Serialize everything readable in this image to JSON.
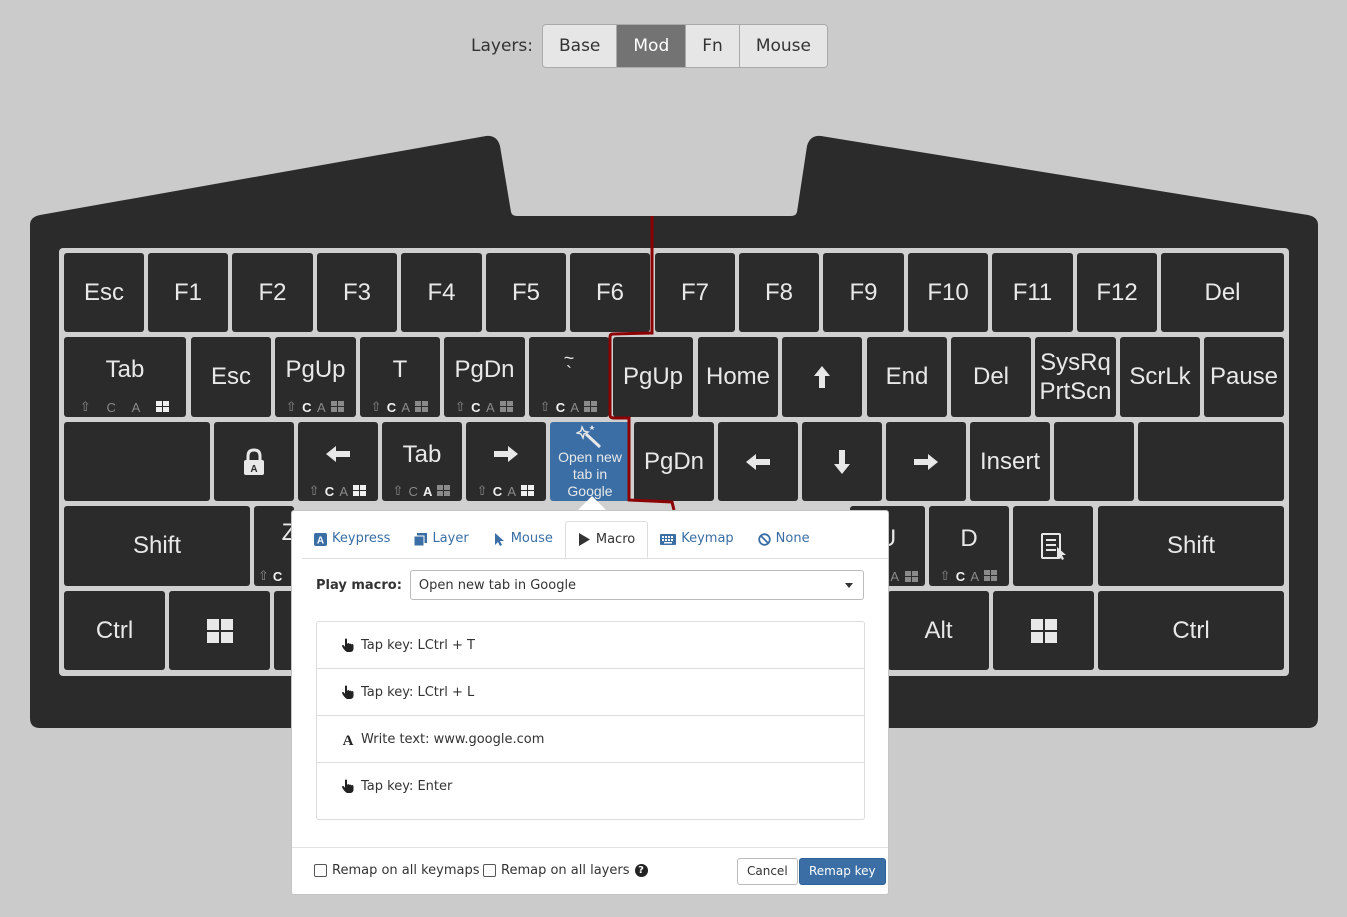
{
  "layers": {
    "label": "Layers:",
    "items": [
      {
        "label": "Base",
        "active": false
      },
      {
        "label": "Mod",
        "active": true
      },
      {
        "label": "Fn",
        "active": false
      },
      {
        "label": "Mouse",
        "active": false
      }
    ]
  },
  "keys": {
    "esc": "Esc",
    "f1": "F1",
    "f2": "F2",
    "f3": "F3",
    "f4": "F4",
    "f5": "F5",
    "f6": "F6",
    "f7": "F7",
    "f8": "F8",
    "f9": "F9",
    "f10": "F10",
    "f11": "F11",
    "f12": "F12",
    "del": "Del",
    "tab_l": "Tab",
    "esc2": "Esc",
    "pgup_l": "PgUp",
    "t": "T",
    "pgdn_l": "PgDn",
    "tilde": "~",
    "backtick": "`",
    "pgup_r": "PgUp",
    "home": "Home",
    "end": "End",
    "del2": "Del",
    "sysrq": "SysRq",
    "prtscn": "PrtScn",
    "scrlk": "ScrLk",
    "pause": "Pause",
    "tab2": "Tab",
    "macro_key": "Open new\ntab in Google",
    "pgdn_r": "PgDn",
    "insert": "Insert",
    "shift_l": "Shift",
    "z_partial": "Z",
    "u_partial": "U",
    "d": "D",
    "shift_r": "Shift",
    "ctrl_l": "Ctrl",
    "alt_r": "Alt",
    "ctrl_r": "Ctrl",
    "mod_c": "C",
    "mod_a": "A"
  },
  "popover": {
    "tabs": [
      {
        "label": "Keypress",
        "icon": "keypress-icon",
        "active": false
      },
      {
        "label": "Layer",
        "icon": "layer-icon",
        "active": false
      },
      {
        "label": "Mouse",
        "icon": "mouse-pointer-icon",
        "active": false
      },
      {
        "label": "Macro",
        "icon": "play-icon",
        "active": true
      },
      {
        "label": "Keymap",
        "icon": "keyboard-icon",
        "active": false
      },
      {
        "label": "None",
        "icon": "ban-icon",
        "active": false
      }
    ],
    "play_macro_label": "Play macro:",
    "selected_macro": "Open new tab in Google",
    "actions": [
      {
        "icon": "hand-pointer-icon",
        "text": "Tap key: LCtrl + T"
      },
      {
        "icon": "hand-pointer-icon",
        "text": "Tap key: LCtrl + L"
      },
      {
        "icon": "font-icon",
        "text": "Write text: www.google.com"
      },
      {
        "icon": "hand-pointer-icon",
        "text": "Tap key: Enter"
      }
    ],
    "remap_all_keymaps": "Remap on all keymaps",
    "remap_all_layers": "Remap on all layers",
    "help": "?",
    "cancel": "Cancel",
    "remap": "Remap key"
  },
  "colors": {
    "background": "#cbcbcb",
    "keyboard": "#2b2b2b",
    "key_border": "#d0d0d0",
    "split_line": "#8b0000",
    "accent": "#3a6ea5",
    "active_layer": "#737373"
  }
}
